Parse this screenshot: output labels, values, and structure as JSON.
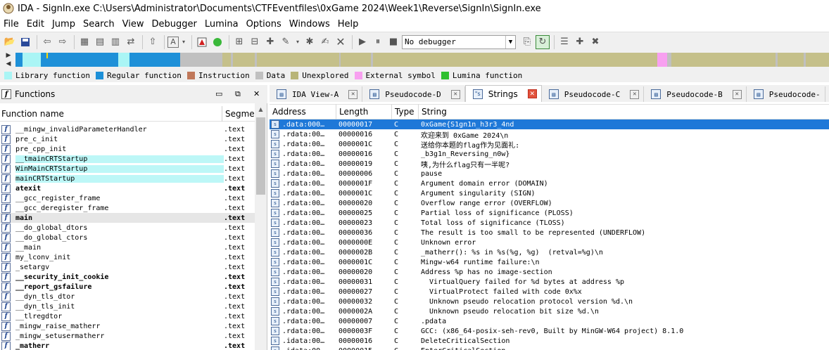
{
  "window": {
    "title": "IDA - SignIn.exe C:\\Users\\Administrator\\Documents\\CTFEventfiles\\0xGame 2024\\Week1\\Reverse\\SignIn\\SignIn.exe"
  },
  "menu": [
    "File",
    "Edit",
    "Jump",
    "Search",
    "View",
    "Debugger",
    "Lumina",
    "Options",
    "Windows",
    "Help"
  ],
  "toolbar": {
    "debugger_select": "No debugger"
  },
  "legend": [
    {
      "label": "Library function",
      "color": "#aaf5f5"
    },
    {
      "label": "Regular function",
      "color": "#1e90d8"
    },
    {
      "label": "Instruction",
      "color": "#c0785a"
    },
    {
      "label": "Data",
      "color": "#c0c0c0"
    },
    {
      "label": "Unexplored",
      "color": "#b8b478"
    },
    {
      "label": "External symbol",
      "color": "#f8a0f0"
    },
    {
      "label": "Lumina function",
      "color": "#30c030"
    }
  ],
  "functions_panel": {
    "title": "Functions",
    "col_name": "Function name",
    "col_segment": "Segme",
    "rows": [
      {
        "name": "__mingw_invalidParameterHandler",
        "seg": ".text",
        "lib": false,
        "bold": false
      },
      {
        "name": "pre_c_init",
        "seg": ".text",
        "lib": false,
        "bold": false
      },
      {
        "name": "pre_cpp_init",
        "seg": ".text",
        "lib": false,
        "bold": false
      },
      {
        "name": "__tmainCRTStartup",
        "seg": ".text",
        "lib": true,
        "bold": false
      },
      {
        "name": "WinMainCRTStartup",
        "seg": ".text",
        "lib": true,
        "bold": false
      },
      {
        "name": "mainCRTStartup",
        "seg": ".text",
        "lib": true,
        "bold": false
      },
      {
        "name": "atexit",
        "seg": ".text",
        "lib": false,
        "bold": true
      },
      {
        "name": "__gcc_register_frame",
        "seg": ".text",
        "lib": false,
        "bold": false
      },
      {
        "name": "__gcc_deregister_frame",
        "seg": ".text",
        "lib": false,
        "bold": false
      },
      {
        "name": "main",
        "seg": ".text",
        "lib": false,
        "bold": true,
        "sel": true
      },
      {
        "name": "__do_global_dtors",
        "seg": ".text",
        "lib": false,
        "bold": false
      },
      {
        "name": "__do_global_ctors",
        "seg": ".text",
        "lib": false,
        "bold": false
      },
      {
        "name": "__main",
        "seg": ".text",
        "lib": false,
        "bold": false
      },
      {
        "name": "my_lconv_init",
        "seg": ".text",
        "lib": false,
        "bold": false
      },
      {
        "name": "_setargv",
        "seg": ".text",
        "lib": false,
        "bold": false
      },
      {
        "name": "__security_init_cookie",
        "seg": ".text",
        "lib": false,
        "bold": true
      },
      {
        "name": "__report_gsfailure",
        "seg": ".text",
        "lib": false,
        "bold": true
      },
      {
        "name": "__dyn_tls_dtor",
        "seg": ".text",
        "lib": false,
        "bold": false
      },
      {
        "name": "__dyn_tls_init",
        "seg": ".text",
        "lib": false,
        "bold": false
      },
      {
        "name": "__tlregdtor",
        "seg": ".text",
        "lib": false,
        "bold": false
      },
      {
        "name": "_mingw_raise_matherr",
        "seg": ".text",
        "lib": false,
        "bold": false
      },
      {
        "name": "_mingw_setusermatherr",
        "seg": ".text",
        "lib": false,
        "bold": false
      },
      {
        "name": "_matherr",
        "seg": ".text",
        "lib": false,
        "bold": true
      }
    ]
  },
  "tabs": [
    {
      "label": "IDA View-A",
      "active": false
    },
    {
      "label": "Pseudocode-D",
      "active": false
    },
    {
      "label": "Strings",
      "active": true
    },
    {
      "label": "Pseudocode-C",
      "active": false
    },
    {
      "label": "Pseudocode-B",
      "active": false
    },
    {
      "label": "Pseudocode-",
      "active": false
    }
  ],
  "strings_table": {
    "headers": [
      "Address",
      "Length",
      "Type",
      "String"
    ],
    "rows": [
      {
        "addr": ".data:000…",
        "len": "00000017",
        "type": "C",
        "str": "0xGame{S1gn1n_h3r3_4nd",
        "sel": true
      },
      {
        "addr": ".rdata:00…",
        "len": "00000016",
        "type": "C",
        "str": "欢迎来到 0xGame 2024\\n"
      },
      {
        "addr": ".rdata:00…",
        "len": "0000001C",
        "type": "C",
        "str": "送给你本题的flag作为见面礼:"
      },
      {
        "addr": ".rdata:00…",
        "len": "00000016",
        "type": "C",
        "str": "_b3g1n_Reversing_n0w}"
      },
      {
        "addr": ".rdata:00…",
        "len": "00000019",
        "type": "C",
        "str": "咦,为什么flag只有一半呢?"
      },
      {
        "addr": ".rdata:00…",
        "len": "00000006",
        "type": "C",
        "str": "pause"
      },
      {
        "addr": ".rdata:00…",
        "len": "0000001F",
        "type": "C",
        "str": "Argument domain error (DOMAIN)"
      },
      {
        "addr": ".rdata:00…",
        "len": "0000001C",
        "type": "C",
        "str": "Argument singularity (SIGN)"
      },
      {
        "addr": ".rdata:00…",
        "len": "00000020",
        "type": "C",
        "str": "Overflow range error (OVERFLOW)"
      },
      {
        "addr": ".rdata:00…",
        "len": "00000025",
        "type": "C",
        "str": "Partial loss of significance (PLOSS)"
      },
      {
        "addr": ".rdata:00…",
        "len": "00000023",
        "type": "C",
        "str": "Total loss of significance (TLOSS)"
      },
      {
        "addr": ".rdata:00…",
        "len": "00000036",
        "type": "C",
        "str": "The result is too small to be represented (UNDERFLOW)"
      },
      {
        "addr": ".rdata:00…",
        "len": "0000000E",
        "type": "C",
        "str": "Unknown error"
      },
      {
        "addr": ".rdata:00…",
        "len": "0000002B",
        "type": "C",
        "str": "_matherr(): %s in %s(%g, %g)  (retval=%g)\\n"
      },
      {
        "addr": ".rdata:00…",
        "len": "0000001C",
        "type": "C",
        "str": "Mingw-w64 runtime failure:\\n"
      },
      {
        "addr": ".rdata:00…",
        "len": "00000020",
        "type": "C",
        "str": "Address %p has no image-section"
      },
      {
        "addr": ".rdata:00…",
        "len": "00000031",
        "type": "C",
        "str": "  VirtualQuery failed for %d bytes at address %p"
      },
      {
        "addr": ".rdata:00…",
        "len": "00000027",
        "type": "C",
        "str": "  VirtualProtect failed with code 0x%x"
      },
      {
        "addr": ".rdata:00…",
        "len": "00000032",
        "type": "C",
        "str": "  Unknown pseudo relocation protocol version %d.\\n"
      },
      {
        "addr": ".rdata:00…",
        "len": "0000002A",
        "type": "C",
        "str": "  Unknown pseudo relocation bit size %d.\\n"
      },
      {
        "addr": ".rdata:00…",
        "len": "00000007",
        "type": "C",
        "str": ".pdata"
      },
      {
        "addr": ".rdata:00…",
        "len": "0000003F",
        "type": "C",
        "str": "GCC: (x86_64-posix-seh-rev0, Built by MinGW-W64 project) 8.1.0"
      },
      {
        "addr": ".idata:00…",
        "len": "00000016",
        "type": "C",
        "str": "DeleteCriticalSection"
      },
      {
        "addr": ".idata:00…",
        "len": "00000015",
        "type": "C",
        "str": "EnterCriticalSection"
      }
    ]
  }
}
